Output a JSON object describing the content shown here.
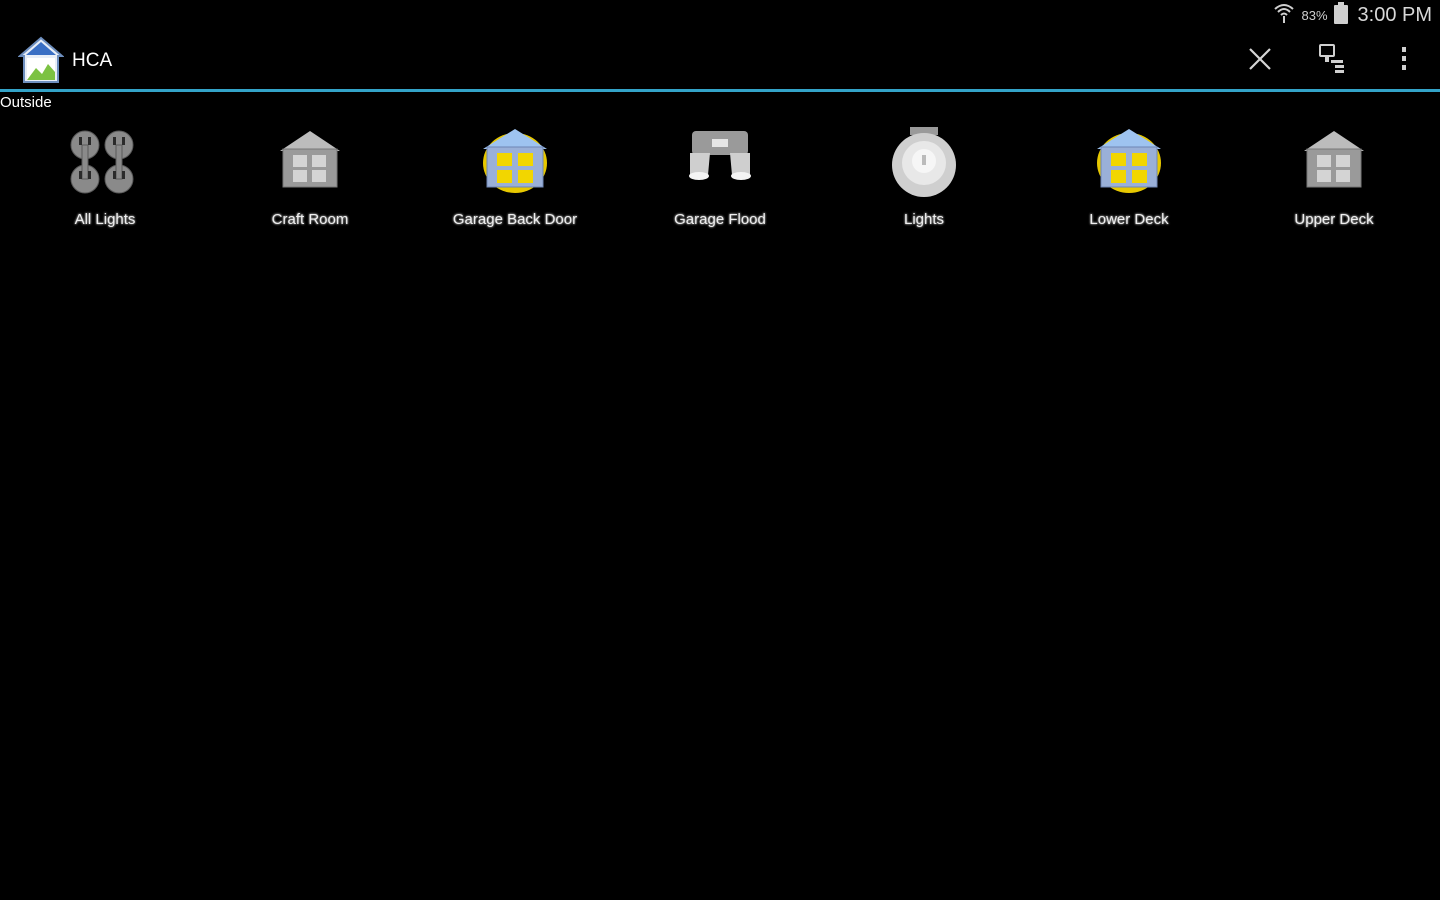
{
  "status_bar": {
    "battery_pct": "83%",
    "time": "3:00 PM",
    "icons": [
      "wifi-icon",
      "battery-icon"
    ]
  },
  "action_bar": {
    "title": "HCA",
    "app_icon": "hca-house-logo-icon",
    "actions": [
      {
        "name": "close",
        "icon": "close-icon"
      },
      {
        "name": "display-view",
        "icon": "display-device-icon"
      },
      {
        "name": "overflow",
        "icon": "more-vertical-icon"
      }
    ],
    "divider_color": "#33a3c8"
  },
  "section": {
    "label": "Outside"
  },
  "tiles": [
    {
      "label": "All Lights",
      "icon": "outlet-group-icon"
    },
    {
      "label": "Craft Room",
      "icon": "house-off-icon"
    },
    {
      "label": "Garage Back Door",
      "icon": "house-on-icon"
    },
    {
      "label": "Garage Flood",
      "icon": "flood-light-icon"
    },
    {
      "label": "Lights",
      "icon": "light-bulb-icon"
    },
    {
      "label": "Lower Deck",
      "icon": "house-on-icon"
    },
    {
      "label": "Upper Deck",
      "icon": "house-off-icon"
    }
  ],
  "colors": {
    "background": "#000000",
    "accent": "#33a3c8",
    "on_glow": "#f2d600",
    "off_gray": "#9a9a9a"
  }
}
